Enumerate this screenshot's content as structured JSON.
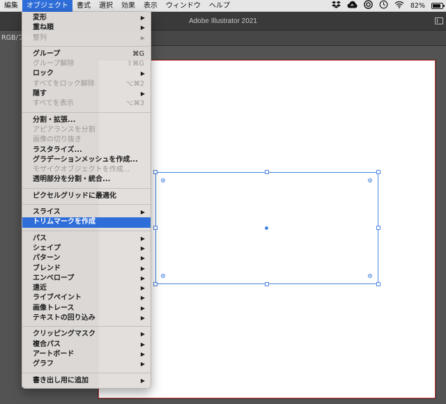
{
  "menubar": {
    "items": [
      "編集",
      "オブジェクト",
      "書式",
      "選択",
      "効果",
      "表示",
      "ウィンドウ",
      "ヘルプ"
    ],
    "battery": "82%",
    "battery_level": 0.82
  },
  "app": {
    "title": "Adobe Illustrator 2021",
    "doc_tab": "RGB/プレビュー"
  },
  "menu": {
    "groups": [
      [
        {
          "label": "変形",
          "submenu": true
        },
        {
          "label": "重ね順",
          "submenu": true
        },
        {
          "label": "整列",
          "submenu": true,
          "disabled": true
        }
      ],
      [
        {
          "label": "グループ",
          "shortcut": "⌘G"
        },
        {
          "label": "グループ解除",
          "shortcut": "⇧⌘G",
          "disabled": true
        },
        {
          "label": "ロック",
          "submenu": true
        },
        {
          "label": "すべてをロック解除",
          "shortcut": "⌥⌘2",
          "disabled": true
        },
        {
          "label": "隠す",
          "submenu": true
        },
        {
          "label": "すべてを表示",
          "shortcut": "⌥⌘3",
          "disabled": true
        }
      ],
      [
        {
          "label": "分割・拡張..."
        },
        {
          "label": "アピアランスを分割",
          "disabled": true
        },
        {
          "label": "画像の切り抜き",
          "disabled": true
        },
        {
          "label": "ラスタライズ..."
        },
        {
          "label": "グラデーションメッシュを作成..."
        },
        {
          "label": "モザイクオブジェクトを作成...",
          "disabled": true
        },
        {
          "label": "透明部分を分割・統合..."
        }
      ],
      [
        {
          "label": "ピクセルグリッドに最適化"
        }
      ],
      [
        {
          "label": "スライス",
          "submenu": true
        },
        {
          "label": "トリムマークを作成",
          "highlight": true
        }
      ],
      [
        {
          "label": "パス",
          "submenu": true
        },
        {
          "label": "シェイプ",
          "submenu": true
        },
        {
          "label": "パターン",
          "submenu": true
        },
        {
          "label": "ブレンド",
          "submenu": true
        },
        {
          "label": "エンベロープ",
          "submenu": true
        },
        {
          "label": "遠近",
          "submenu": true
        },
        {
          "label": "ライブペイント",
          "submenu": true
        },
        {
          "label": "画像トレース",
          "submenu": true
        },
        {
          "label": "テキストの回り込み",
          "submenu": true
        }
      ],
      [
        {
          "label": "クリッピングマスク",
          "submenu": true
        },
        {
          "label": "複合パス",
          "submenu": true
        },
        {
          "label": "アートボード",
          "submenu": true
        },
        {
          "label": "グラフ",
          "submenu": true
        }
      ],
      [
        {
          "label": "書き出し用に追加",
          "submenu": true
        }
      ]
    ]
  },
  "colors": {
    "accent": "#2f6ed9",
    "selection": "#4a86e0",
    "artboard_border": "#c73a3a"
  }
}
